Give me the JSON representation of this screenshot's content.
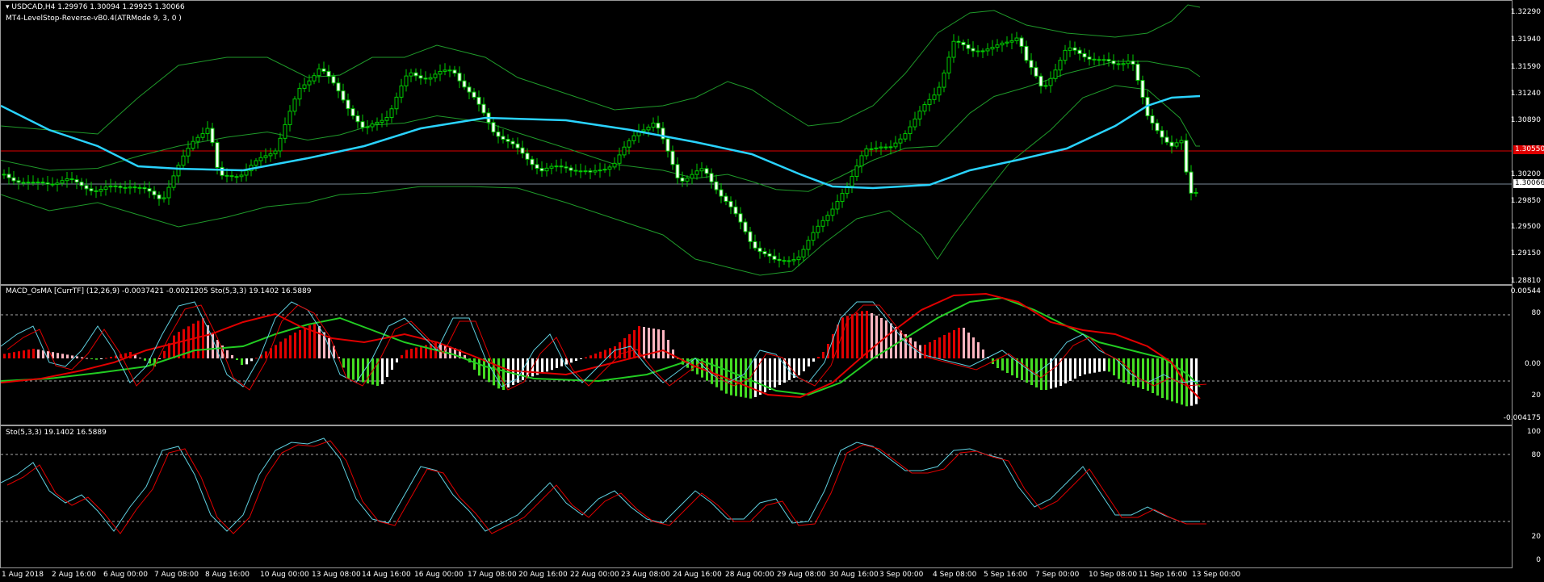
{
  "main": {
    "symbol_line": "USDCAD,H4  1.29976 1.30094 1.29925 1.30066",
    "indicator_line": "MT4-LevelStop-Reverse-vB0.4(ATRMode 9, 3, 0 )",
    "price_ticks": [
      "1.32290",
      "1.31940",
      "1.31590",
      "1.31240",
      "1.30890",
      "1.30550",
      "1.30200",
      "1.29850",
      "1.29500",
      "1.29150",
      "1.28810"
    ],
    "level_price": "1.30550",
    "current_price": "1.30066",
    "colors": {
      "level": "#e00000",
      "ma": "#2ad3ff",
      "bands": "#1f9a2a",
      "candle": "#00cc00",
      "candle_bear": "#ffffff"
    }
  },
  "macd": {
    "title": "MACD_OsMA [CurrTF] (12,26,9) -0.0037421 -0.0021205  Sto(5,3,3) 19.1402 16.5889",
    "ticks": [
      "0.00544",
      "80",
      "0.00",
      "20",
      "-0.004175"
    ]
  },
  "stoch": {
    "title": "Sto(5,3,3) 19.1402 16.5889",
    "ticks": [
      "100",
      "80",
      "20",
      "0"
    ]
  },
  "time_axis": [
    "1 Aug 2018",
    "2 Aug 16:00",
    "6 Aug 00:00",
    "7 Aug 08:00",
    "8 Aug 16:00",
    "10 Aug 00:00",
    "13 Aug 08:00",
    "14 Aug 16:00",
    "16 Aug 00:00",
    "17 Aug 08:00",
    "20 Aug 16:00",
    "22 Aug 00:00",
    "23 Aug 08:00",
    "24 Aug 16:00",
    "28 Aug 00:00",
    "29 Aug 08:00",
    "30 Aug 16:00",
    "3 Sep 00:00",
    "4 Sep 08:00",
    "5 Sep 16:00",
    "7 Sep 00:00",
    "10 Sep 08:00",
    "11 Sep 16:00",
    "13 Sep 00:00"
  ]
}
